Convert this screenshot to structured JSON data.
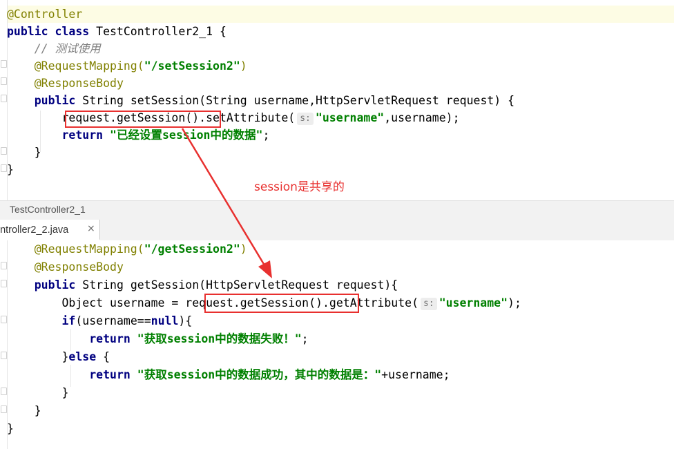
{
  "top_editor": {
    "lines": [
      {
        "parts": [
          [
            "@Controller",
            "anno"
          ]
        ]
      },
      {
        "parts": [
          [
            "public class ",
            "kw"
          ],
          [
            "TestController2_1 {",
            ""
          ]
        ]
      },
      {
        "parts": [
          [
            "    // ",
            "cmt"
          ],
          [
            "测试使用",
            "cmt cjk"
          ]
        ]
      },
      {
        "parts": [
          [
            "    @RequestMapping(",
            "anno"
          ],
          [
            "\"/setSession2\"",
            "str"
          ],
          [
            ")",
            "anno"
          ]
        ]
      },
      {
        "parts": [
          [
            "    @ResponseBody",
            "anno"
          ]
        ]
      },
      {
        "parts": [
          [
            "    public ",
            "kw"
          ],
          [
            "String setSession(String username,HttpServletRequest request) {",
            ""
          ]
        ]
      },
      {
        "parts": [
          [
            "        request.getSession().setAttribute(",
            ""
          ],
          [
            "s:",
            "hint"
          ],
          [
            "\"username\"",
            "str"
          ],
          [
            ",username);",
            ""
          ]
        ]
      },
      {
        "parts": [
          [
            "        return ",
            "kw"
          ],
          [
            "\"",
            "str"
          ],
          [
            "已经设置",
            "str cjk"
          ],
          [
            "session",
            "str"
          ],
          [
            "中的数据",
            "str cjk"
          ],
          [
            "\"",
            "str"
          ],
          [
            ";",
            ""
          ]
        ]
      },
      {
        "parts": [
          [
            "    }",
            ""
          ]
        ]
      },
      {
        "parts": [
          [
            "}",
            ""
          ]
        ]
      }
    ]
  },
  "divider": {
    "title": "TestController2_1"
  },
  "tab": {
    "label": "ontroller2_2.java",
    "close": "×"
  },
  "bottom_editor": {
    "lines": [
      {
        "parts": [
          [
            "    @RequestMapping(",
            "anno"
          ],
          [
            "\"/getSession2\"",
            "str"
          ],
          [
            ")",
            "anno"
          ]
        ]
      },
      {
        "parts": [
          [
            "    @ResponseBody",
            "anno"
          ]
        ]
      },
      {
        "parts": [
          [
            "    public ",
            "kw"
          ],
          [
            "String getSession(HttpServletRequest request){",
            ""
          ]
        ]
      },
      {
        "parts": [
          [
            "        Object username = request.getSession().getAttribute(",
            ""
          ],
          [
            "s:",
            "hint"
          ],
          [
            "\"username\"",
            "str"
          ],
          [
            ");",
            ""
          ]
        ]
      },
      {
        "parts": [
          [
            "        ",
            ""
          ],
          [
            "if",
            "kw"
          ],
          [
            "(username==",
            ""
          ],
          [
            "null",
            "kw"
          ],
          [
            "){",
            ""
          ]
        ]
      },
      {
        "parts": [
          [
            "            return ",
            "kw"
          ],
          [
            "\"",
            "str"
          ],
          [
            "获取",
            "str cjk"
          ],
          [
            "session",
            "str"
          ],
          [
            "中的数据失败！",
            "str cjk"
          ],
          [
            "\"",
            "str"
          ],
          [
            ";",
            ""
          ]
        ]
      },
      {
        "parts": [
          [
            "        }",
            ""
          ],
          [
            "else ",
            "kw"
          ],
          [
            "{",
            ""
          ]
        ]
      },
      {
        "parts": [
          [
            "            return ",
            "kw"
          ],
          [
            "\"",
            "str"
          ],
          [
            "获取",
            "str cjk"
          ],
          [
            "session",
            "str"
          ],
          [
            "中的数据成功，其中的数据是：",
            "str cjk"
          ],
          [
            "\"",
            "str"
          ],
          [
            "+username;",
            ""
          ]
        ]
      },
      {
        "parts": [
          [
            "        }",
            ""
          ]
        ]
      },
      {
        "parts": [
          [
            "    }",
            ""
          ]
        ]
      },
      {
        "parts": [
          [
            "}",
            ""
          ]
        ]
      }
    ]
  },
  "annotation": {
    "text": "session是共享的",
    "color": "#e8302f"
  }
}
